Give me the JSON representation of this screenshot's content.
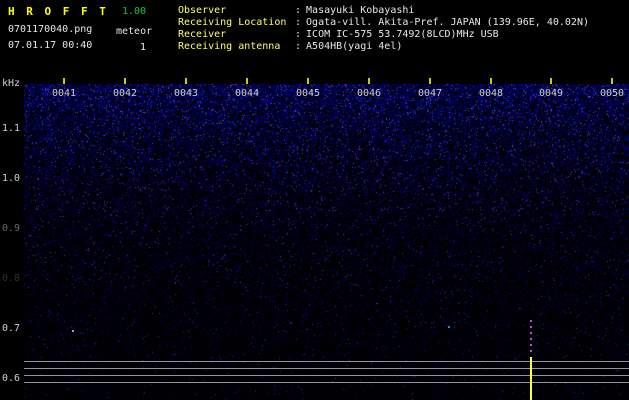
{
  "header": {
    "title": "H R O F F T",
    "version": "1.00",
    "filename": "0701170040.png",
    "mode": "meteor",
    "datetime": "07.01.17 00:40",
    "count": "1",
    "sep": ":",
    "info_rows": [
      {
        "label": "Observer",
        "value": "Masayuki Kobayashi"
      },
      {
        "label": "Receiving Location",
        "value": "Ogata-vill. Akita-Pref. JAPAN (139.96E, 40.02N)"
      },
      {
        "label": "Receiver",
        "value": "ICOM IC-575 53.7492(8LCD)MHz USB"
      },
      {
        "label": "Receiving antenna",
        "value": "A504HB(yagi 4el)"
      }
    ]
  },
  "spectrogram": {
    "unit_label": "kHz",
    "freq_labels": [
      "1.1",
      "1.0",
      "0.9",
      "0.8",
      "0.7",
      "0.6"
    ],
    "time_labels": [
      "0041",
      "0042",
      "0043",
      "0044",
      "0045",
      "0046",
      "0047",
      "0048",
      "0049",
      "0050"
    ]
  },
  "colors": {
    "title": "#ffff00",
    "version": "#00cc44",
    "info_label": "#ffff66",
    "info_value": "#e8e8e8",
    "axis_text": "#cfcfcf",
    "tick": "#cccc00",
    "echo_trace": "#c050dc",
    "echo_spike": "#ffff44"
  }
}
